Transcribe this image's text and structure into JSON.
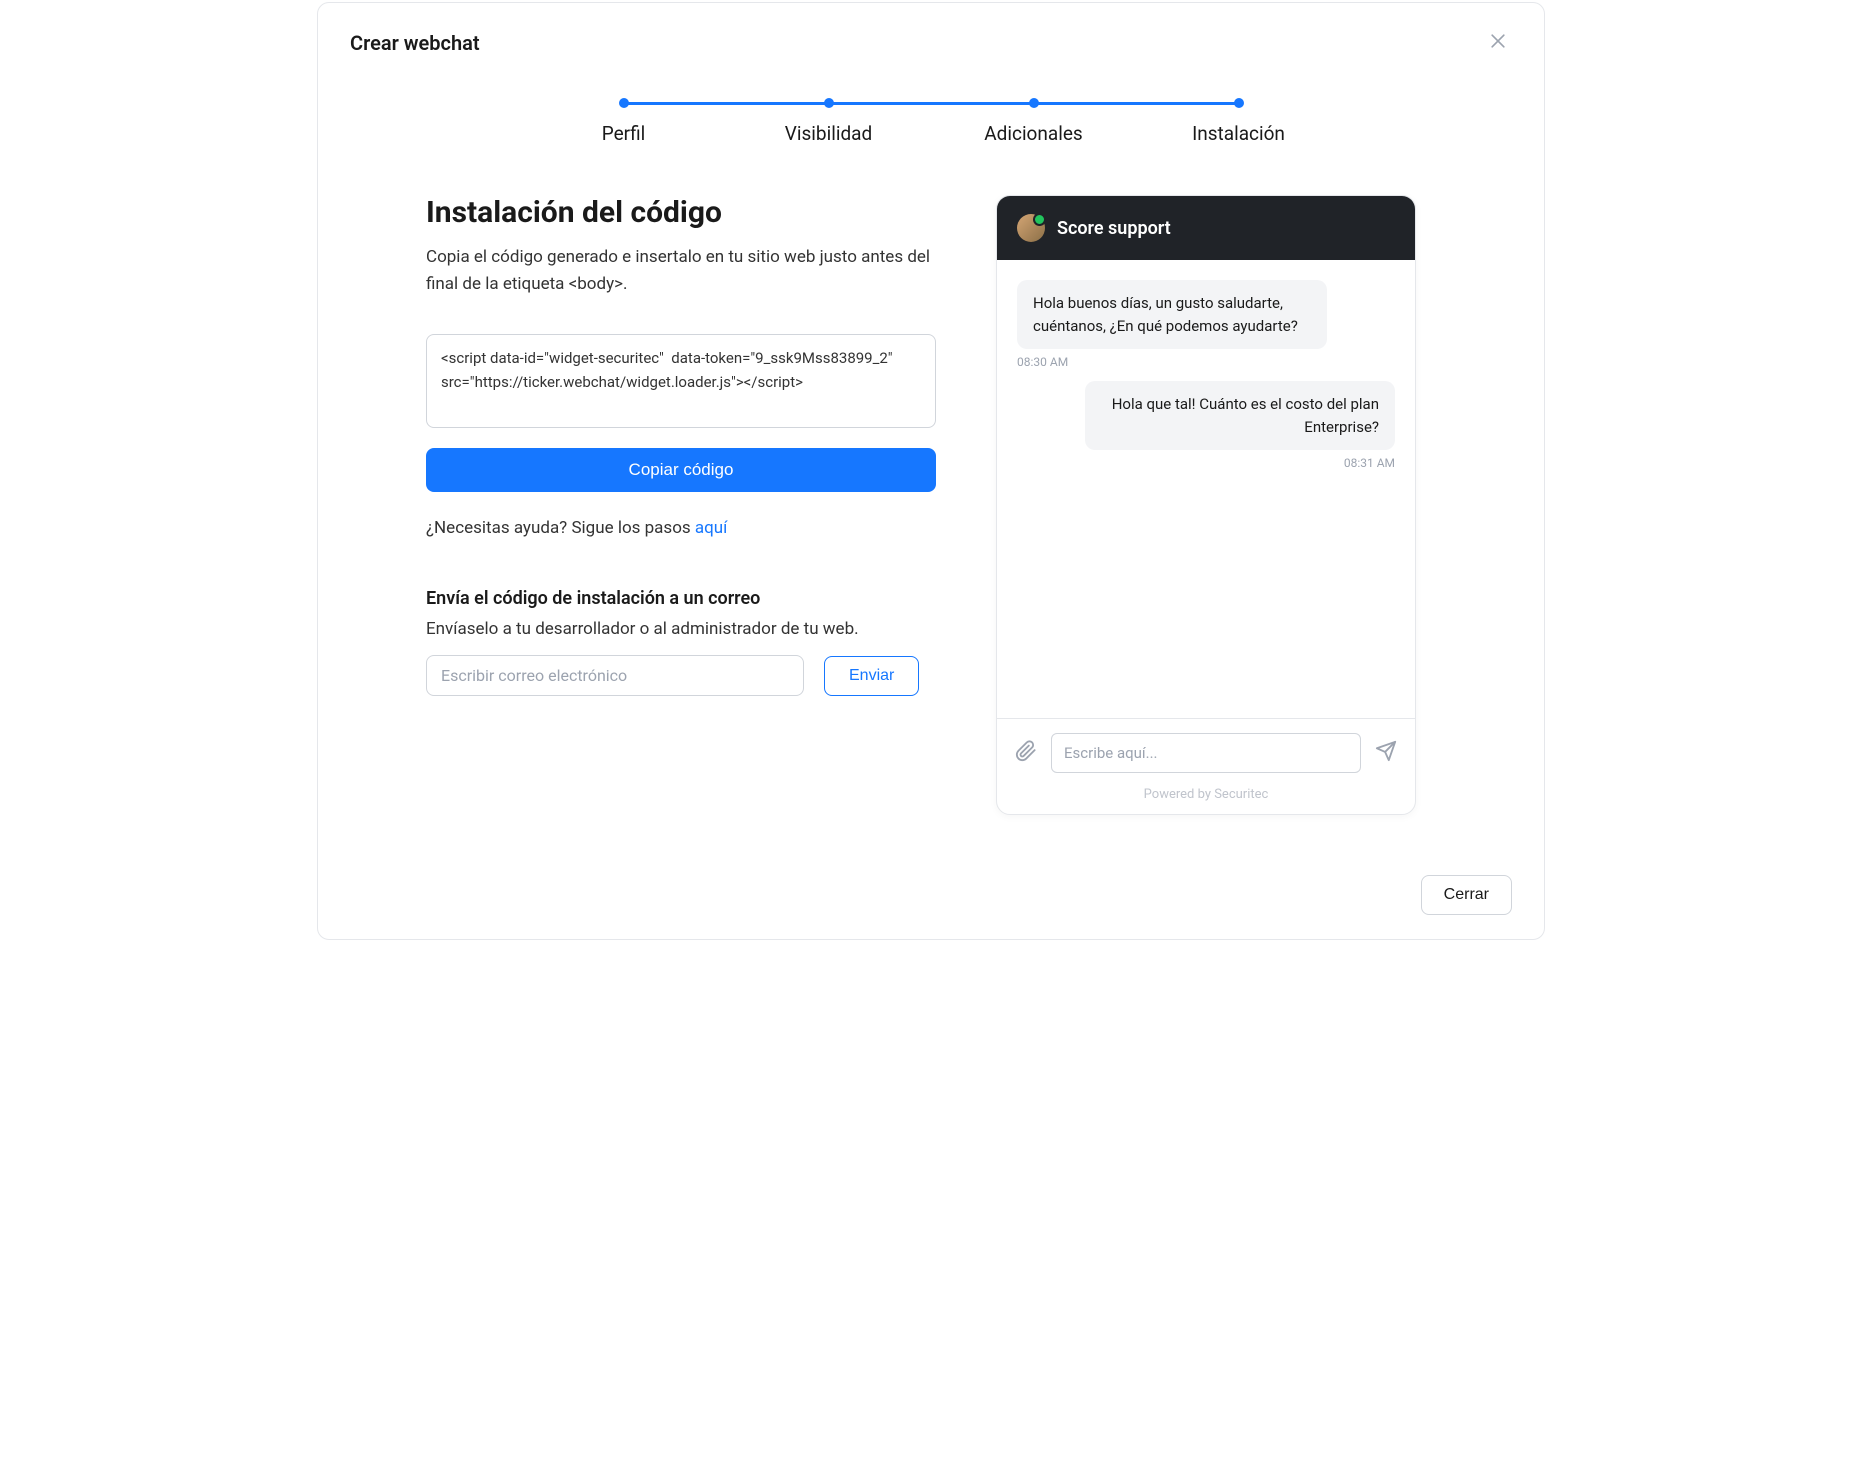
{
  "modal": {
    "title": "Crear webchat",
    "close_footer_label": "Cerrar"
  },
  "stepper": {
    "steps": [
      {
        "label": "Perfil"
      },
      {
        "label": "Visibilidad"
      },
      {
        "label": "Adicionales"
      },
      {
        "label": "Instalación"
      }
    ]
  },
  "install": {
    "title": "Instalación del código",
    "description": "Copia  el código generado e insertalo  en tu sitio web justo antes del final de la etiqueta <body>.",
    "code": "<script data-id=\"widget-securitec\"  data-token=\"9_ssk9Mss83899_2\"  src=\"https://ticker.webchat/widget.loader.js\"></script>",
    "copy_label": "Copiar código",
    "help_prefix": "¿Necesitas ayuda? Sigue los pasos ",
    "help_link": "aquí"
  },
  "email_section": {
    "title": "Envía el código de instalación a un correo",
    "description": "Envíaselo a tu desarrollador o al administrador de tu web.",
    "placeholder": "Escribir correo electrónico",
    "send_label": "Enviar"
  },
  "chat": {
    "title": "Score support",
    "messages": [
      {
        "side": "left",
        "text": "Hola buenos días, un gusto saludarte, cuéntanos, ¿En qué podemos ayudarte?",
        "time": "08:30 AM"
      },
      {
        "side": "right",
        "text": "Hola que tal! Cuánto es el costo del plan Enterprise?",
        "time": "08:31 AM"
      }
    ],
    "input_placeholder": "Escribe aquí...",
    "powered": "Powered by Securitec"
  }
}
